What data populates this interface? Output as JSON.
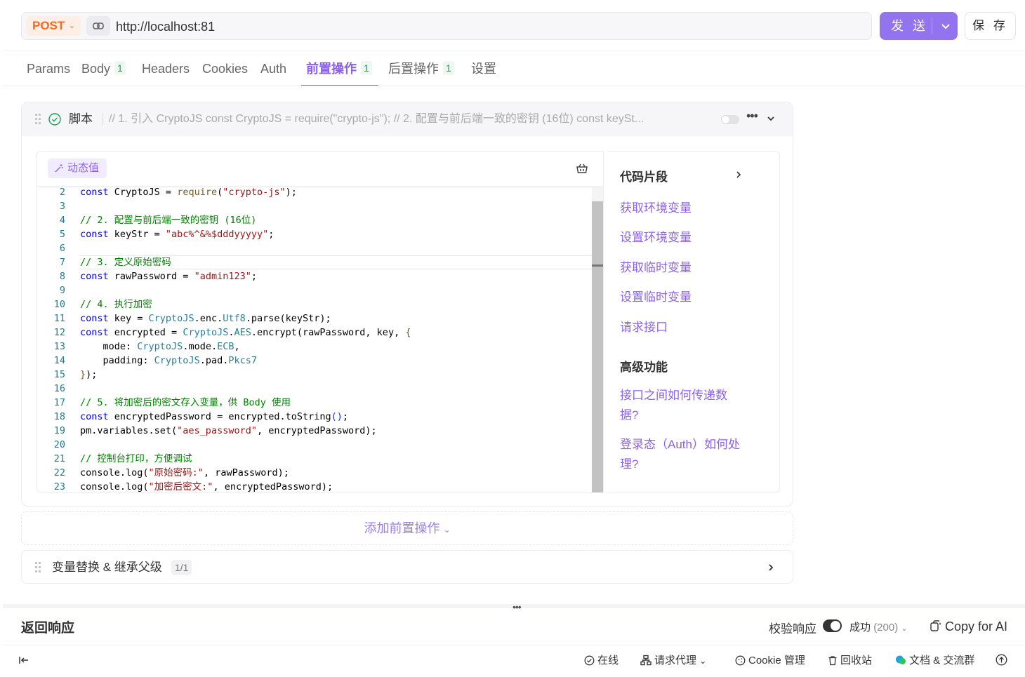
{
  "request": {
    "method": "POST",
    "url": "http://localhost:81",
    "send_label": "发 送",
    "save_label": "保 存"
  },
  "tabs": [
    {
      "label": "Params",
      "count": ""
    },
    {
      "label": "Body",
      "count": "1"
    },
    {
      "label": "Headers",
      "count": ""
    },
    {
      "label": "Cookies",
      "count": ""
    },
    {
      "label": "Auth",
      "count": ""
    },
    {
      "label": "前置操作",
      "count": "1",
      "active": true
    },
    {
      "label": "后置操作",
      "count": "1"
    },
    {
      "label": "设置",
      "count": ""
    }
  ],
  "script_card": {
    "title": "脚本",
    "preview": "// 1. 引入 CryptoJS const CryptoJS = require(\"crypto-js\"); // 2. 配置与前后端一致的密钥 (16位) const keySt...",
    "dynamic_value_label": "动态值"
  },
  "code_lines": [
    {
      "n": "2",
      "html": "<span class=\"k\">const</span> CryptoJS = <span class=\"f\">require</span>(<span class=\"s\">\"crypto-js\"</span>);"
    },
    {
      "n": "3",
      "html": ""
    },
    {
      "n": "4",
      "html": "<span class=\"c\">// 2. 配置与前后端一致的密钥 (16位)</span>"
    },
    {
      "n": "5",
      "html": "<span class=\"k\">const</span> keyStr = <span class=\"s\">\"abc%^&%$dddyyyyy\"</span>;"
    },
    {
      "n": "6",
      "html": ""
    },
    {
      "n": "7",
      "html": "<span class=\"c\">// 3. 定义原始密码</span>"
    },
    {
      "n": "8",
      "html": "<span class=\"k\">const</span> rawPassword = <span class=\"s\">\"admin123\"</span>;"
    },
    {
      "n": "9",
      "html": ""
    },
    {
      "n": "10",
      "html": "<span class=\"c\">// 4. 执行加密</span>"
    },
    {
      "n": "11",
      "html": "<span class=\"k\">const</span> key = <span class=\"t\">CryptoJS</span>.enc.<span class=\"t\">Utf8</span>.parse(keyStr);"
    },
    {
      "n": "12",
      "html": "<span class=\"k\">const</span> encrypted = <span class=\"t\">CryptoJS</span>.<span class=\"t\">AES</span>.encrypt(rawPassword, key, <span class=\"f\">{</span>"
    },
    {
      "n": "13",
      "html": "    mode: <span class=\"t\">CryptoJS</span>.mode.<span class=\"t\">ECB</span>,"
    },
    {
      "n": "14",
      "html": "    padding: <span class=\"t\">CryptoJS</span>.pad.<span class=\"t\">Pkcs7</span>"
    },
    {
      "n": "15",
      "html": "<span class=\"f\">}</span>);"
    },
    {
      "n": "16",
      "html": ""
    },
    {
      "n": "17",
      "html": "<span class=\"c\">// 5. 将加密后的密文存入变量，供 Body 使用</span>"
    },
    {
      "n": "18",
      "html": "<span class=\"k\">const</span> encryptedPassword = encrypted.toString<span class=\"p\">()</span>;"
    },
    {
      "n": "19",
      "html": "pm.variables.set(<span class=\"s\">\"aes_password\"</span>, encryptedPassword);"
    },
    {
      "n": "20",
      "html": ""
    },
    {
      "n": "21",
      "html": "<span class=\"c\">// 控制台打印，方便调试</span>"
    },
    {
      "n": "22",
      "html": "console.log(<span class=\"s\">\"原始密码:\"</span>, rawPassword);"
    },
    {
      "n": "23",
      "html": "console.log(<span class=\"s\">\"加密后密文:\"</span>, encryptedPassword);"
    }
  ],
  "snippets": {
    "header": "代码片段",
    "links": [
      "获取环境变量",
      "设置环境变量",
      "获取临时变量",
      "设置临时变量",
      "请求接口"
    ],
    "advanced_header": "高级功能",
    "advanced_links": [
      "接口之间如何传递数据?",
      "登录态（Auth）如何处理?"
    ]
  },
  "add_pre_action": "添加前置操作",
  "variable_row": {
    "label": "变量替换 & 继承父级",
    "count": "1/1"
  },
  "response": {
    "title": "返回响应",
    "verify_label": "校验响应",
    "status_label": "成功",
    "status_code": "(200)",
    "copy_ai": "Copy for AI"
  },
  "footer": {
    "online": "在线",
    "proxy": "请求代理",
    "cookie": "Cookie 管理",
    "trash": "回收站",
    "docs": "文档 & 交流群"
  },
  "colors": {
    "accent": "#8a63e8",
    "send": "#9373ee",
    "post": "#f26a21",
    "success": "#18a058"
  }
}
